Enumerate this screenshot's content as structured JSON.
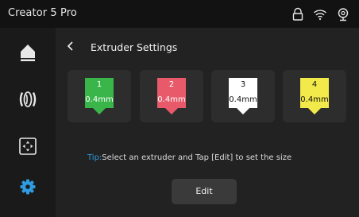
{
  "app": {
    "title": "Creator 5 Pro"
  },
  "status_icons": [
    "lock-icon",
    "wifi-icon",
    "camera-icon"
  ],
  "sidebar": {
    "items": [
      {
        "icon": "home-icon",
        "active": false
      },
      {
        "icon": "filament-spool-icon",
        "active": false
      },
      {
        "icon": "move-control-icon",
        "active": false
      },
      {
        "icon": "settings-gear-icon",
        "active": true
      }
    ]
  },
  "page": {
    "title": "Extruder Settings"
  },
  "extruders": [
    {
      "number": "1",
      "size": "0.4mm",
      "color": "#3ab54a",
      "text_color": "#ffffff"
    },
    {
      "number": "2",
      "size": "0.4mm",
      "color": "#e8596a",
      "text_color": "#ffffff"
    },
    {
      "number": "3",
      "size": "0.4mm",
      "color": "#ffffff",
      "text_color": "#111111"
    },
    {
      "number": "4",
      "size": "0.4mm",
      "color": "#f2e94a",
      "text_color": "#111111"
    }
  ],
  "tip": {
    "label": "Tip:",
    "text": "Select an extruder and Tap [Edit] to set the size"
  },
  "actions": {
    "edit_label": "Edit"
  },
  "colors": {
    "accent": "#2f9be0",
    "topbar": "#121212",
    "sidebar": "#1a1a1a",
    "background": "#222222",
    "card": "#2d2d2d"
  }
}
